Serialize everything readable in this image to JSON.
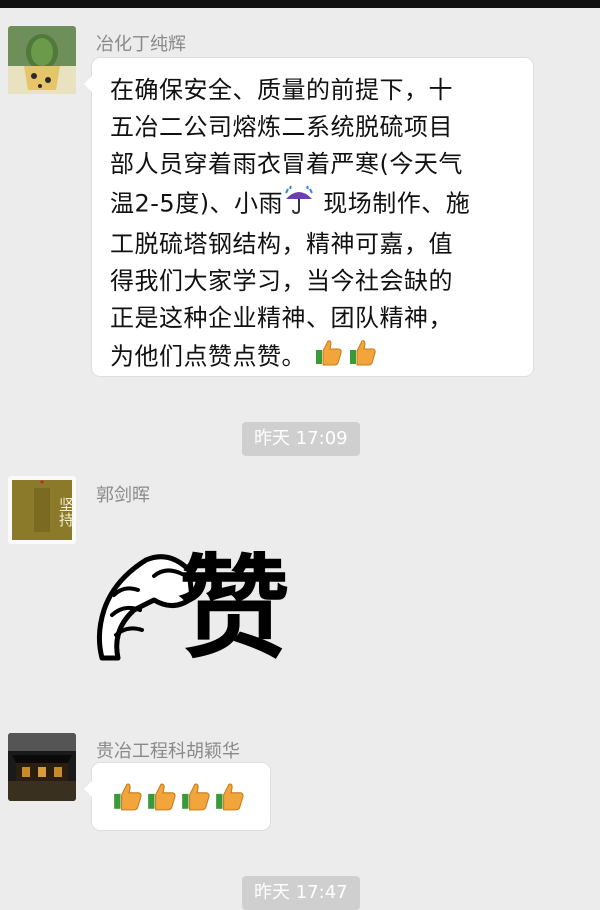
{
  "messages": [
    {
      "sender": "冶化丁纯辉",
      "text": "在确保安全、质量的前提下，十\n五冶二公司熔炼二系统脱硫项目\n部人员穿着雨衣冒着严寒(今天气\n温2-5度)、小雨",
      "text_after_umbrella": " 现场制作、施\n工脱硫塔钢结构，精神可嘉，值\n得我们大家学习，当今社会缺的\n正是这种企业精神、团队精神，\n为他们点赞点赞。"
    },
    {
      "sender": "郭剑晖",
      "avatar_text": "坚持",
      "sticker_text": "赞"
    },
    {
      "sender": "贵冶工程科胡颖华"
    }
  ],
  "timestamps": [
    "昨天 17:09",
    "昨天 17:47"
  ],
  "colors": {
    "background": "#ececec",
    "bubble": "#ffffff",
    "name": "#8a8a8a",
    "timestamp_bg": "#cfcfcf"
  }
}
